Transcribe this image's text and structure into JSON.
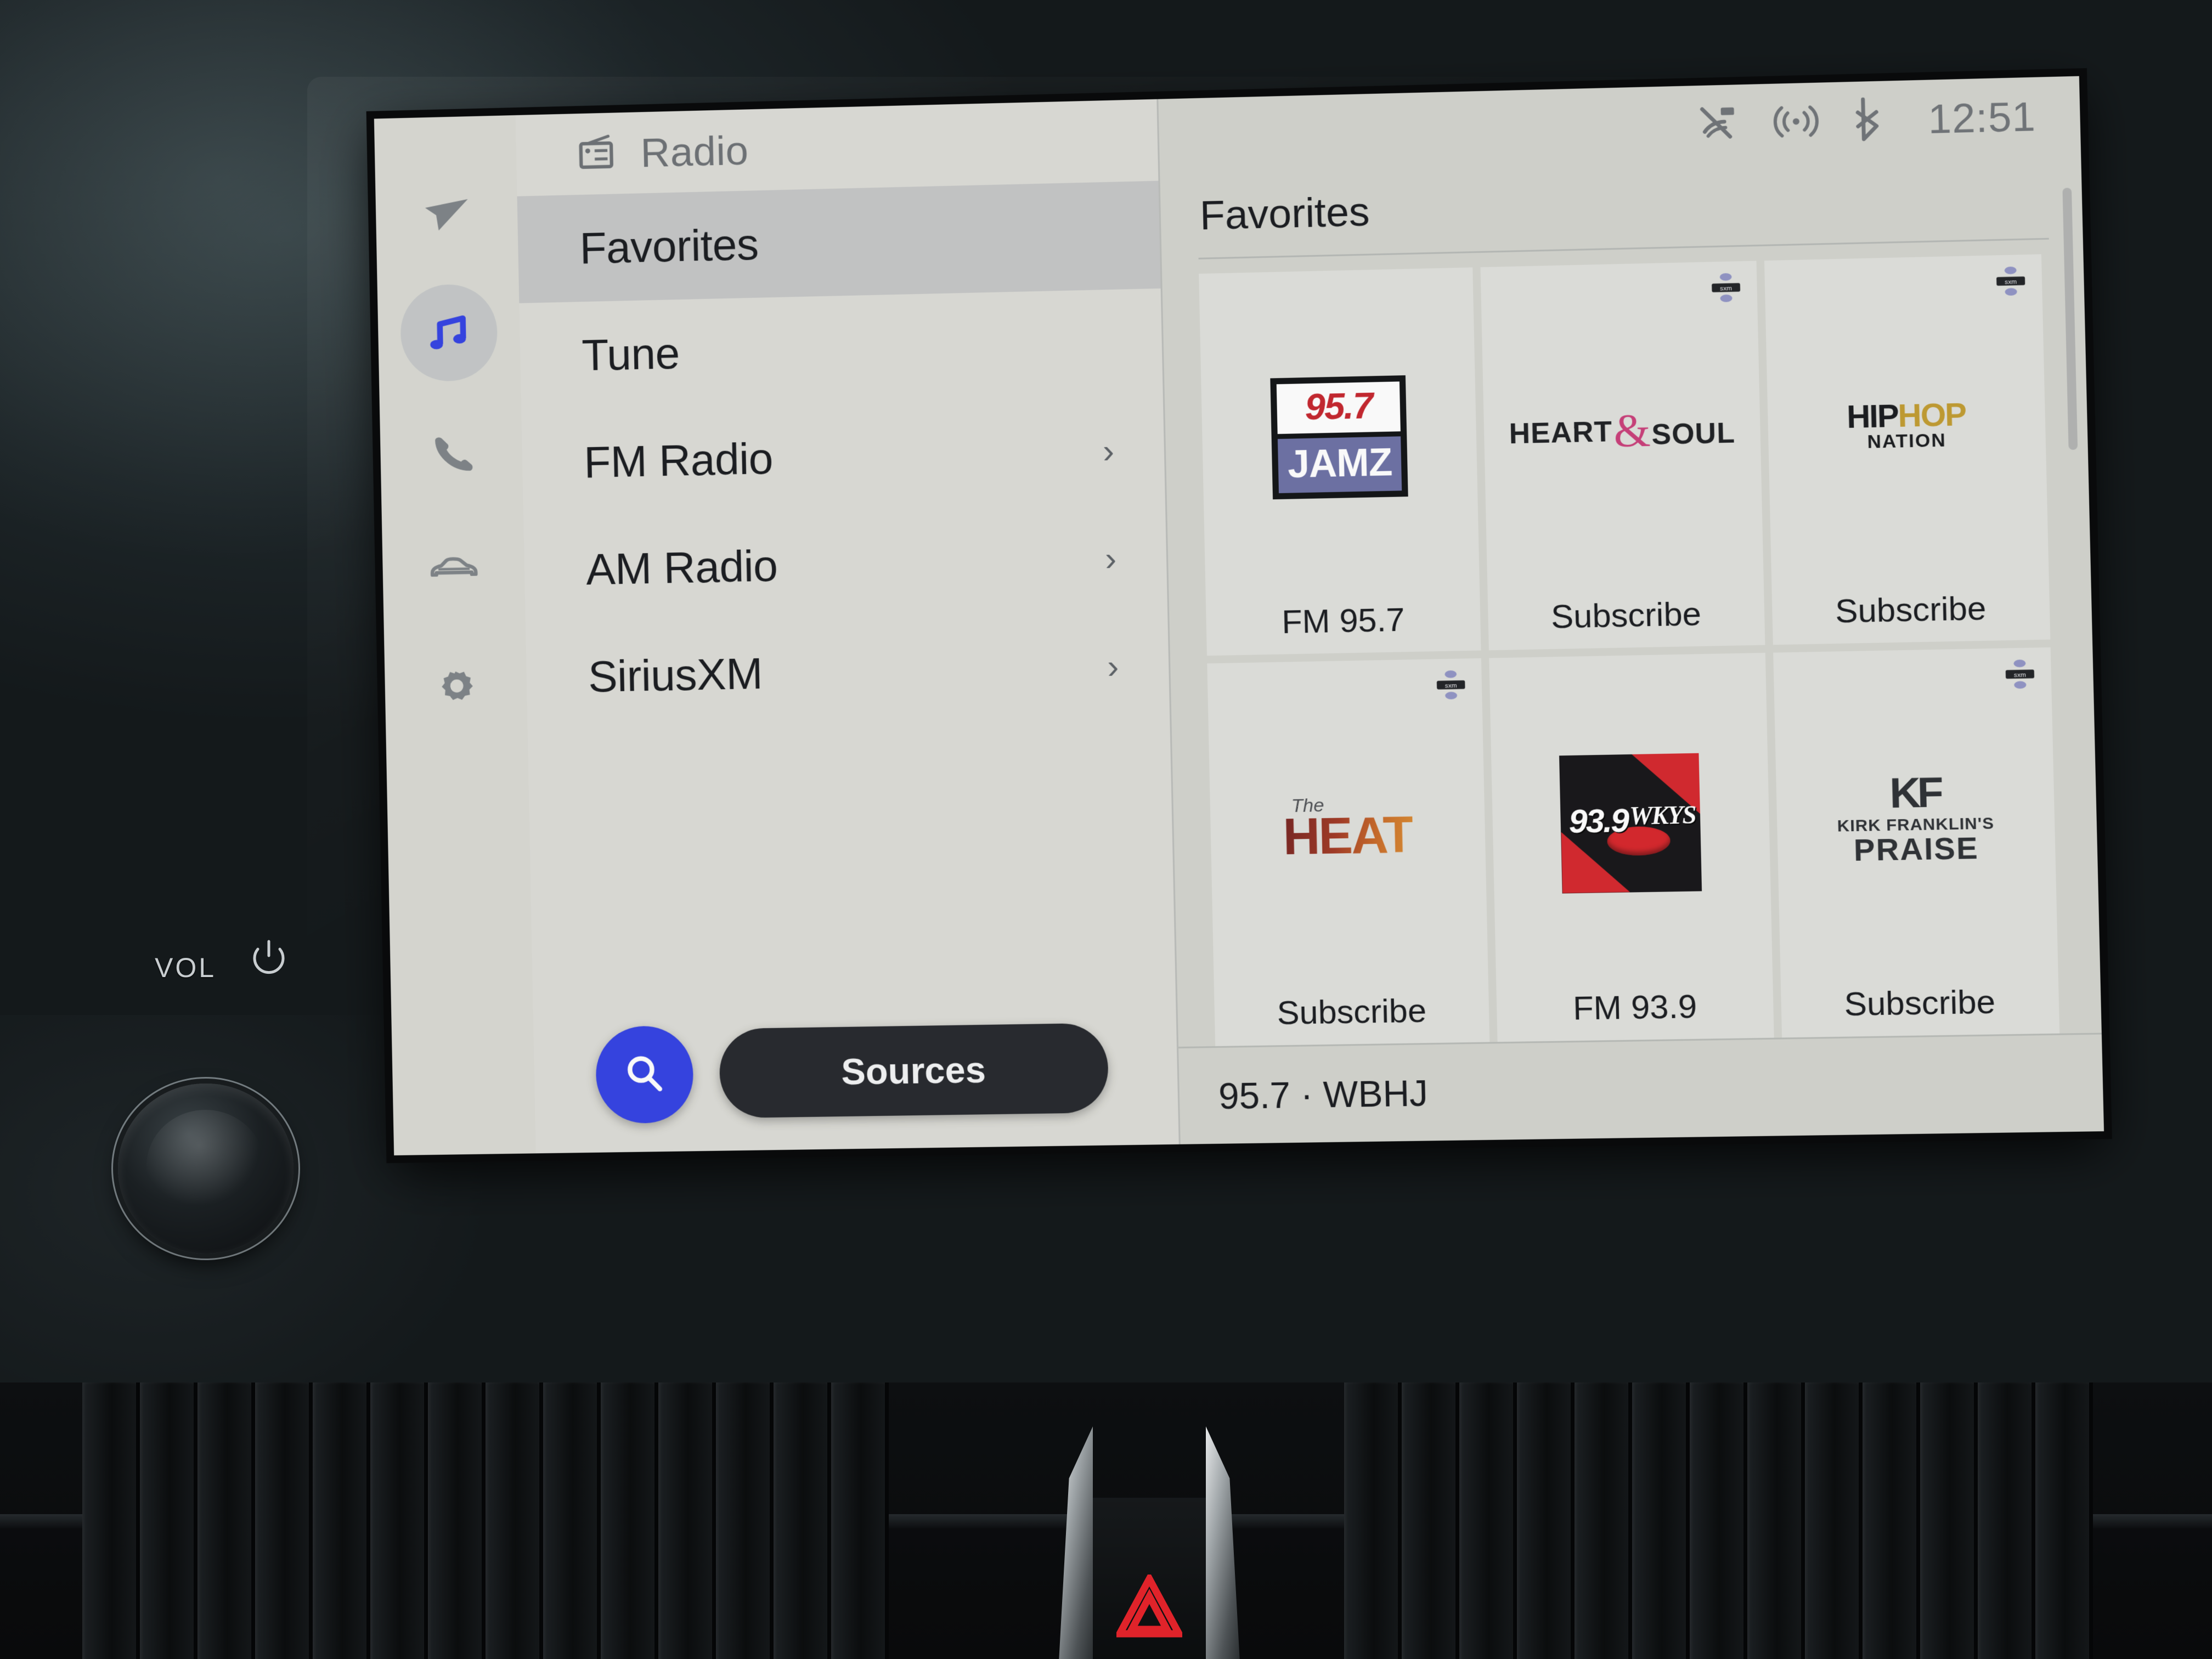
{
  "hardware": {
    "vol_label": "VOL",
    "power_icon": "power-icon",
    "knob_name": "volume-power-knob",
    "hazard_icon": "hazard-triangle-icon"
  },
  "sidebar": {
    "items": [
      {
        "icon": "navigation-arrow-icon",
        "name": "navigation",
        "active": false
      },
      {
        "icon": "music-note-icon",
        "name": "media",
        "active": true
      },
      {
        "icon": "phone-icon",
        "name": "phone",
        "active": false
      },
      {
        "icon": "car-icon",
        "name": "vehicle",
        "active": false
      },
      {
        "icon": "gear-icon",
        "name": "settings",
        "active": false
      }
    ],
    "active_color": "#2f3ff0"
  },
  "menu": {
    "header": {
      "icon": "radio-icon",
      "title": "Radio"
    },
    "rows": [
      {
        "label": "Favorites",
        "chevron": "",
        "selected": true
      },
      {
        "label": "Tune",
        "chevron": "",
        "selected": false
      },
      {
        "label": "FM Radio",
        "chevron": "›",
        "selected": false
      },
      {
        "label": "AM Radio",
        "chevron": "›",
        "selected": false
      },
      {
        "label": "SiriusXM",
        "chevron": "›",
        "selected": false
      }
    ],
    "search_icon": "search-icon",
    "sources_label": "Sources"
  },
  "statusbar": {
    "icons": [
      {
        "name": "microphone-muted-icon"
      },
      {
        "name": "broadcast-waves-icon"
      },
      {
        "name": "bluetooth-icon"
      }
    ],
    "clock": "12:51"
  },
  "favorites": {
    "title": "Favorites",
    "tiles": [
      {
        "label": "FM 95.7",
        "logo": "jamz",
        "logo_top": "95.7",
        "logo_bottom": "JAMZ",
        "sxm_badge": false
      },
      {
        "label": "Subscribe",
        "logo": "heart-and-soul",
        "logo_part1": "HEART",
        "logo_amp": "&",
        "logo_part2": "SOUL",
        "sxm_badge": true
      },
      {
        "label": "Subscribe",
        "logo": "hip-hop-nation",
        "logo_hip": "HIP",
        "logo_hop": "HOP",
        "logo_nation": "NATION",
        "sxm_badge": true
      },
      {
        "label": "Subscribe",
        "logo": "the-heat",
        "logo_the": "The",
        "logo_heat": "HEAT",
        "sxm_badge": true
      },
      {
        "label": "FM 93.9",
        "logo": "wkys",
        "logo_freq": "93.9",
        "logo_call": "WKYS",
        "sxm_badge": false
      },
      {
        "label": "Subscribe",
        "logo": "kirk-franklins-praise",
        "logo_mono": "KF",
        "logo_line1": "KIRK FRANKLIN'S",
        "logo_line2": "PRAISE",
        "sxm_badge": true
      }
    ],
    "now_playing": "95.7 · WBHJ"
  },
  "colors": {
    "screen_bg": "#dcdcd6",
    "panel_bg": "#d2d3cc",
    "accent_blue": "#2f3ff0",
    "pill_dark": "#23262b",
    "text_primary": "#15181c",
    "text_muted": "#6b6f74"
  }
}
